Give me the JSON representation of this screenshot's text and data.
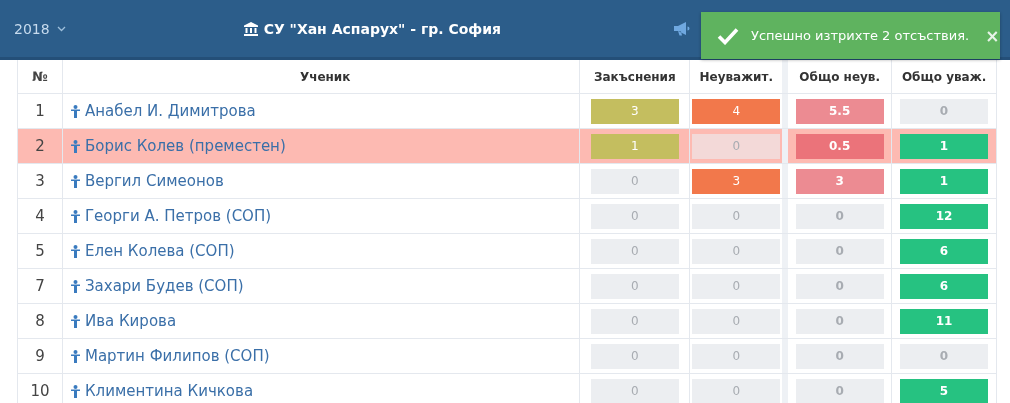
{
  "header": {
    "year": "2018",
    "school_title": "СУ \"Хан Аспарух\" - гр. София"
  },
  "toast": {
    "message": "Успешно изтрихте 2 отсъствия.",
    "close": "×"
  },
  "table": {
    "columns": [
      "№",
      "Ученик",
      "Закъснения",
      "Неуважит.",
      "Общо неув.",
      "Общо уваж."
    ],
    "rows": [
      {
        "highlighted": false,
        "cells": [
          {
            "kind": "number",
            "value": "1"
          },
          {
            "kind": "name",
            "value": "Анабел И. Димитрова"
          },
          {
            "kind": "late",
            "value": "3"
          },
          {
            "kind": "unexcused",
            "value": "4"
          },
          {
            "kind": "total",
            "value": "5.5"
          },
          {
            "kind": "zero",
            "value": "0"
          }
        ]
      },
      {
        "highlighted": true,
        "cells": [
          {
            "kind": "number",
            "value": "2"
          },
          {
            "kind": "name",
            "value": "Борис Колев (преместен)"
          },
          {
            "kind": "late",
            "value": "1"
          },
          {
            "kind": "zero",
            "value": "0"
          },
          {
            "kind": "total",
            "value": "0.5"
          },
          {
            "kind": "excused",
            "value": "1"
          }
        ]
      },
      {
        "highlighted": false,
        "cells": [
          {
            "kind": "number",
            "value": "3"
          },
          {
            "kind": "name",
            "value": "Вергил Симеонов"
          },
          {
            "kind": "zero",
            "value": "0"
          },
          {
            "kind": "unexcused",
            "value": "3"
          },
          {
            "kind": "total",
            "value": "3"
          },
          {
            "kind": "excused",
            "value": "1"
          }
        ]
      },
      {
        "highlighted": false,
        "cells": [
          {
            "kind": "number",
            "value": "4"
          },
          {
            "kind": "name",
            "value": "Георги А. Петров (СОП)"
          },
          {
            "kind": "zero",
            "value": "0"
          },
          {
            "kind": "zero",
            "value": "0"
          },
          {
            "kind": "zero",
            "value": "0"
          },
          {
            "kind": "excused",
            "value": "12"
          }
        ]
      },
      {
        "highlighted": false,
        "cells": [
          {
            "kind": "number",
            "value": "5"
          },
          {
            "kind": "name",
            "value": "Елен Колева (СОП)"
          },
          {
            "kind": "zero",
            "value": "0"
          },
          {
            "kind": "zero",
            "value": "0"
          },
          {
            "kind": "zero",
            "value": "0"
          },
          {
            "kind": "excused",
            "value": "6"
          }
        ]
      },
      {
        "highlighted": false,
        "cells": [
          {
            "kind": "number",
            "value": "7"
          },
          {
            "kind": "name",
            "value": "Захари Будев (СОП)"
          },
          {
            "kind": "zero",
            "value": "0"
          },
          {
            "kind": "zero",
            "value": "0"
          },
          {
            "kind": "zero",
            "value": "0"
          },
          {
            "kind": "excused",
            "value": "6"
          }
        ]
      },
      {
        "highlighted": false,
        "cells": [
          {
            "kind": "number",
            "value": "8"
          },
          {
            "kind": "name",
            "value": "Ива Кирова"
          },
          {
            "kind": "zero",
            "value": "0"
          },
          {
            "kind": "zero",
            "value": "0"
          },
          {
            "kind": "zero",
            "value": "0"
          },
          {
            "kind": "excused",
            "value": "11"
          }
        ]
      },
      {
        "highlighted": false,
        "cells": [
          {
            "kind": "number",
            "value": "9"
          },
          {
            "kind": "name",
            "value": "Мартин Филипов (СОП)"
          },
          {
            "kind": "zero",
            "value": "0"
          },
          {
            "kind": "zero",
            "value": "0"
          },
          {
            "kind": "zero",
            "value": "0"
          },
          {
            "kind": "zero",
            "value": "0"
          }
        ]
      },
      {
        "highlighted": false,
        "cells": [
          {
            "kind": "number",
            "value": "10"
          },
          {
            "kind": "name",
            "value": "Климентина Кичкова"
          },
          {
            "kind": "zero",
            "value": "0"
          },
          {
            "kind": "zero",
            "value": "0"
          },
          {
            "kind": "zero",
            "value": "0"
          },
          {
            "kind": "excused",
            "value": "5"
          }
        ]
      }
    ]
  }
}
